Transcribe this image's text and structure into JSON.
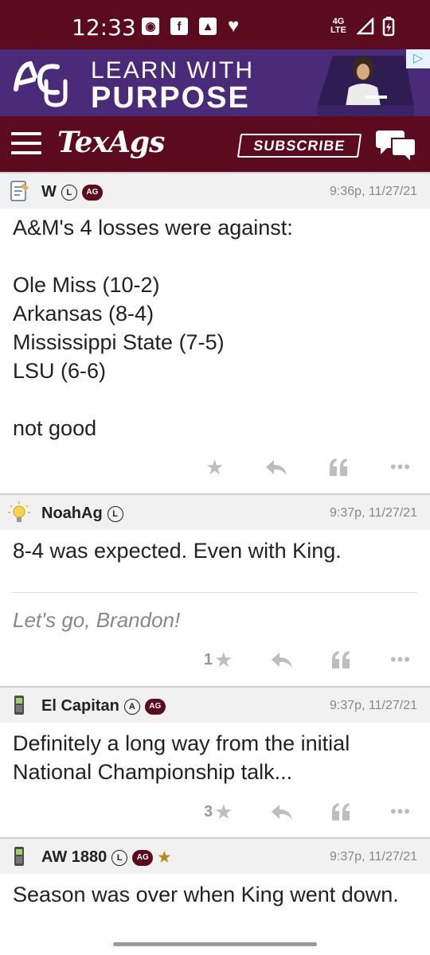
{
  "status_bar": {
    "time": "12:33",
    "network": "4G LTE"
  },
  "ad": {
    "line1": "LEARN WITH",
    "line2": "PURPOSE",
    "adchoices_icon": "adchoices-icon"
  },
  "nav": {
    "brand": "TexAgs",
    "subscribe_label": "SUBSCRIBE",
    "menu_icon": "hamburger-icon",
    "chat_icon": "chat-bubbles-icon"
  },
  "colors": {
    "brand": "#5c0a1e",
    "ad_bg": "#4a2b79",
    "muted": "#888888"
  },
  "posts": [
    {
      "user": "W",
      "badges": [
        "L",
        "AG"
      ],
      "timestamp": "9:36p, 11/27/21",
      "avatar_icon": "notepad-icon",
      "body": "A&M's 4 losses were against:\n\nOle Miss (10-2)\nArkansas (8-4)\nMississippi State (7-5)\nLSU (6-6)\n\nnot good",
      "signature": "",
      "stars": ""
    },
    {
      "user": "NoahAg",
      "badges": [
        "L"
      ],
      "timestamp": "9:37p, 11/27/21",
      "avatar_icon": "lightbulb-icon",
      "body": "8-4 was expected. Even with King.",
      "signature": "Let's go, Brandon!",
      "stars": "1"
    },
    {
      "user": "El Capitan",
      "badges": [
        "A",
        "AG"
      ],
      "timestamp": "9:37p, 11/27/21",
      "avatar_icon": "phone-icon",
      "body": "Definitely a long way from the initial National Championship talk...",
      "signature": "",
      "stars": "3"
    },
    {
      "user": "AW 1880",
      "badges": [
        "L",
        "AG"
      ],
      "timestamp": "9:37p, 11/27/21",
      "avatar_icon": "phone-icon",
      "body": "Season was over when King went down.",
      "signature": "",
      "stars": ""
    }
  ]
}
